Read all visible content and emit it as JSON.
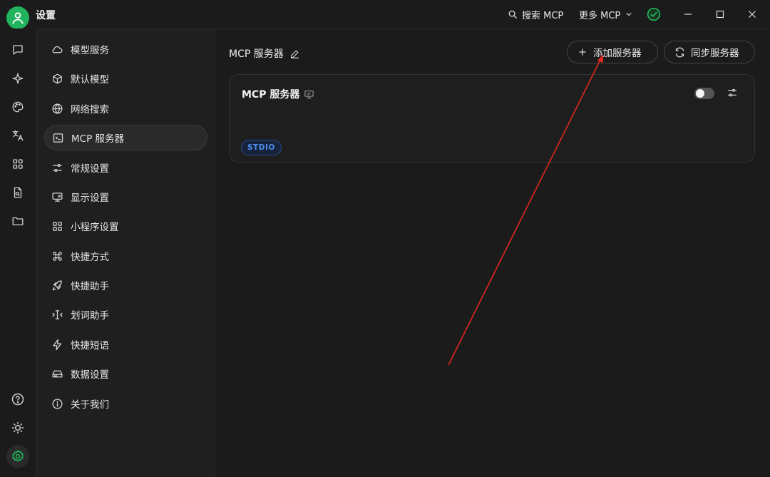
{
  "window": {
    "title": "设置",
    "search_mcp_label": "搜索 MCP",
    "more_mcp_label": "更多 MCP"
  },
  "colors": {
    "accent": "#22b35e",
    "badge_text": "#4f8ff0",
    "annotation": "#e0281e"
  },
  "rail": {
    "items": [
      {
        "icon": "chat-icon"
      },
      {
        "icon": "sparkle-icon"
      },
      {
        "icon": "palette-icon"
      },
      {
        "icon": "translate-icon"
      },
      {
        "icon": "apps-icon"
      },
      {
        "icon": "file-search-icon"
      },
      {
        "icon": "folder-icon"
      },
      {
        "icon": "help-icon"
      },
      {
        "icon": "theme-icon"
      },
      {
        "icon": "settings-icon"
      }
    ]
  },
  "settings_nav": {
    "items": [
      {
        "label": "模型服务",
        "icon": "cloud-icon"
      },
      {
        "label": "默认模型",
        "icon": "cube-icon"
      },
      {
        "label": "网络搜索",
        "icon": "globe-icon"
      },
      {
        "label": "MCP 服务器",
        "icon": "terminal-icon",
        "active": true
      },
      {
        "label": "常规设置",
        "icon": "sliders-icon"
      },
      {
        "label": "显示设置",
        "icon": "monitor-icon"
      },
      {
        "label": "小程序设置",
        "icon": "grid-icon"
      },
      {
        "label": "快捷方式",
        "icon": "command-icon"
      },
      {
        "label": "快捷助手",
        "icon": "rocket-icon"
      },
      {
        "label": "划词助手",
        "icon": "text-select-icon"
      },
      {
        "label": "快捷短语",
        "icon": "zap-icon"
      },
      {
        "label": "数据设置",
        "icon": "hard-drive-icon"
      },
      {
        "label": "关于我们",
        "icon": "info-icon"
      }
    ]
  },
  "main": {
    "title": "MCP 服务器",
    "add_button": "添加服务器",
    "sync_button": "同步服务器",
    "servers": [
      {
        "name": "MCP 服务器",
        "type": "STDIO",
        "enabled": false
      }
    ]
  }
}
